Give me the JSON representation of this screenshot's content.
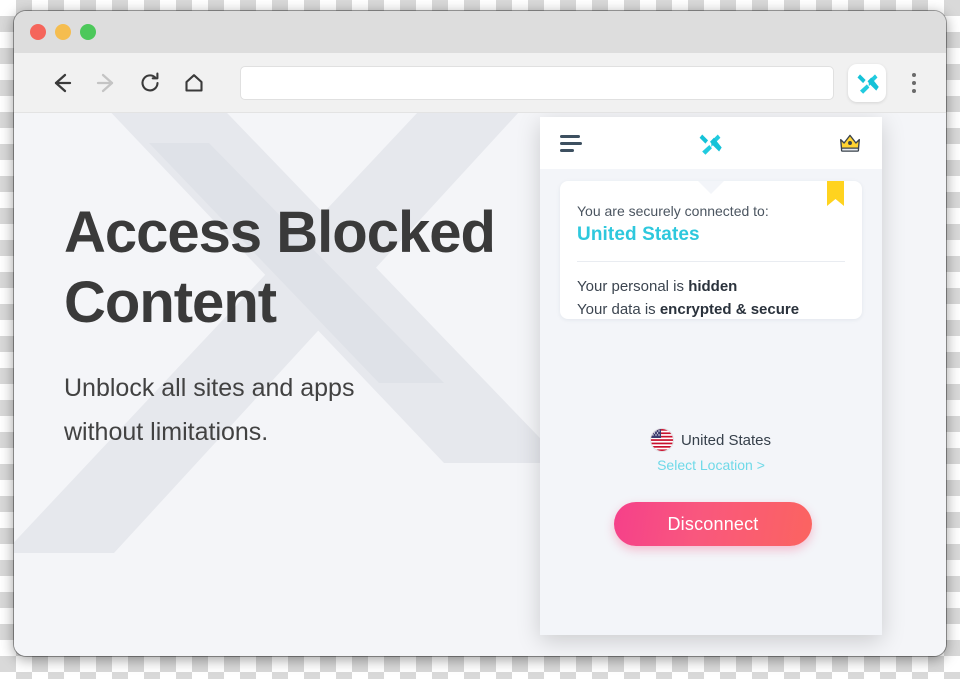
{
  "window": {
    "traffic_lights": [
      {
        "name": "close",
        "color": "#f5655b"
      },
      {
        "name": "minimize",
        "color": "#f5bd4f"
      },
      {
        "name": "maximize",
        "color": "#4cc85a"
      }
    ]
  },
  "toolbar": {
    "back_icon": "arrow-left-icon",
    "forward_icon": "arrow-right-icon",
    "reload_icon": "reload-icon",
    "home_icon": "home-icon",
    "address_value": "",
    "address_placeholder": "",
    "extension_icon": "x-vpn-extension-icon",
    "menu_icon": "kebab-menu-icon"
  },
  "page": {
    "heading": "Access Blocked Content",
    "subheading_line1": "Unblock all sites and apps",
    "subheading_line2": "without limitations.",
    "watermark_icon": "x-logo-watermark"
  },
  "popup": {
    "header": {
      "menu_icon": "hamburger-menu-icon",
      "logo_icon": "x-vpn-logo-icon",
      "premium_icon": "crown-icon"
    },
    "card": {
      "ribbon_icon": "bookmark-ribbon-icon",
      "status_label": "You are securely connected to:",
      "country": "United States",
      "fact1_prefix": "Your personal is ",
      "fact1_strong": "hidden",
      "fact2_prefix": "Your data is ",
      "fact2_strong": "encrypted & secure"
    },
    "location": {
      "flag_icon": "us-flag-icon",
      "name": "United States",
      "select_link": "Select Location >"
    },
    "action": {
      "disconnect_label": "Disconnect"
    }
  },
  "colors": {
    "accent_cyan": "#2ec8dd",
    "link_cyan": "#6fd9e8",
    "button_gradient_start": "#f5408a",
    "button_gradient_end": "#fb6460",
    "ribbon_yellow": "#ffd31f",
    "crown_gold": "#ffd331",
    "page_bg": "#f4f5f8",
    "heading_text": "#3a3a3a"
  }
}
